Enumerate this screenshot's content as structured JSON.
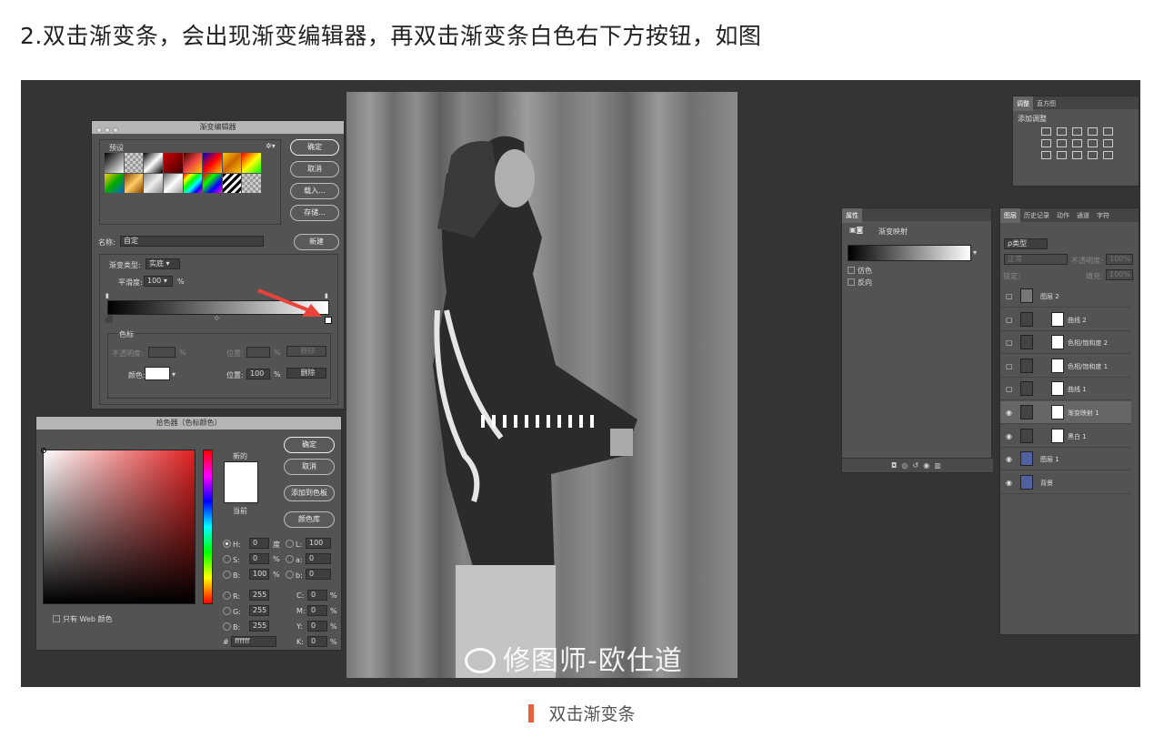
{
  "heading": "2.双击渐变条，会出现渐变编辑器，再双击渐变条白色右下方按钮，如图",
  "caption": "双击渐变条",
  "watermark": "修图师-欧仕道",
  "gradient_editor": {
    "title": "渐变编辑器",
    "presets_label": "预设",
    "ok": "确定",
    "cancel": "取消",
    "load": "载入...",
    "save": "存储...",
    "name_label": "名称:",
    "name_value": "自定",
    "new": "新建",
    "type_label": "渐变类型:",
    "type_value": "实底",
    "smooth_label": "平滑度:",
    "smooth_value": "100",
    "smooth_unit": "%",
    "stops_label": "色标",
    "opacity_label": "不透明度:",
    "opacity_unit": "%",
    "pos_label1": "位置:",
    "pos_unit1": "%",
    "delete1": "删除",
    "color_label": "颜色:",
    "pos_label2": "位置:",
    "pos_value2": "100",
    "pos_unit2": "%",
    "delete2": "删除"
  },
  "color_picker": {
    "title": "拾色器（色标颜色）",
    "ok": "确定",
    "cancel": "取消",
    "add_swatch": "添加到色板",
    "libraries": "颜色库",
    "new_label": "新的",
    "current_label": "当前",
    "web_only": "只有 Web 颜色",
    "h_label": "H:",
    "h_value": "0",
    "h_unit": "度",
    "s_label": "S:",
    "s_value": "0",
    "s_unit": "%",
    "b_label": "B:",
    "b_value": "100",
    "b_unit": "%",
    "r_label": "R:",
    "r_value": "255",
    "g_label": "G:",
    "g_value": "255",
    "bb_label": "B:",
    "bb_value": "255",
    "l_label": "L:",
    "l_value": "100",
    "a_label": "a:",
    "a_value": "0",
    "lb_label": "b:",
    "lb_value": "0",
    "c_label": "C:",
    "c_value": "0",
    "c_unit": "%",
    "m_label": "M:",
    "m_value": "0",
    "m_unit": "%",
    "y_label": "Y:",
    "y_value": "0",
    "y_unit": "%",
    "k_label": "K:",
    "k_value": "0",
    "k_unit": "%",
    "hex_label": "#",
    "hex_value": "ffffff"
  },
  "properties": {
    "tab": "属性",
    "type": "渐变映射",
    "dither": "仿色",
    "reverse": "反向"
  },
  "adjustments": {
    "tab1": "调整",
    "tab2": "直方图",
    "add_label": "添加调整"
  },
  "layers_panel": {
    "tabs": [
      "图层",
      "历史记录",
      "动作",
      "通道",
      "字符"
    ],
    "kind_label": "ρ类型",
    "blend": "正常",
    "opacity_label": "不透明度:",
    "opacity_value": "100%",
    "lock_label": "锁定:",
    "fill_label": "填充:",
    "fill_value": "100%",
    "layers": [
      {
        "name": "图层 2",
        "visible": false
      },
      {
        "name": "曲线 2",
        "visible": false
      },
      {
        "name": "色相/饱和度 2",
        "visible": false
      },
      {
        "name": "色相/饱和度 1",
        "visible": false
      },
      {
        "name": "曲线 1",
        "visible": false
      },
      {
        "name": "渐变映射 1",
        "visible": true
      },
      {
        "name": "黑白 1",
        "visible": true
      },
      {
        "name": "图层 1",
        "visible": true
      },
      {
        "name": "背景",
        "visible": true
      }
    ]
  },
  "colors": {
    "accent_caption": "#e8613f",
    "arrow": "#e8433a",
    "panel_bg": "#535353",
    "canvas_bg": "#343434"
  }
}
